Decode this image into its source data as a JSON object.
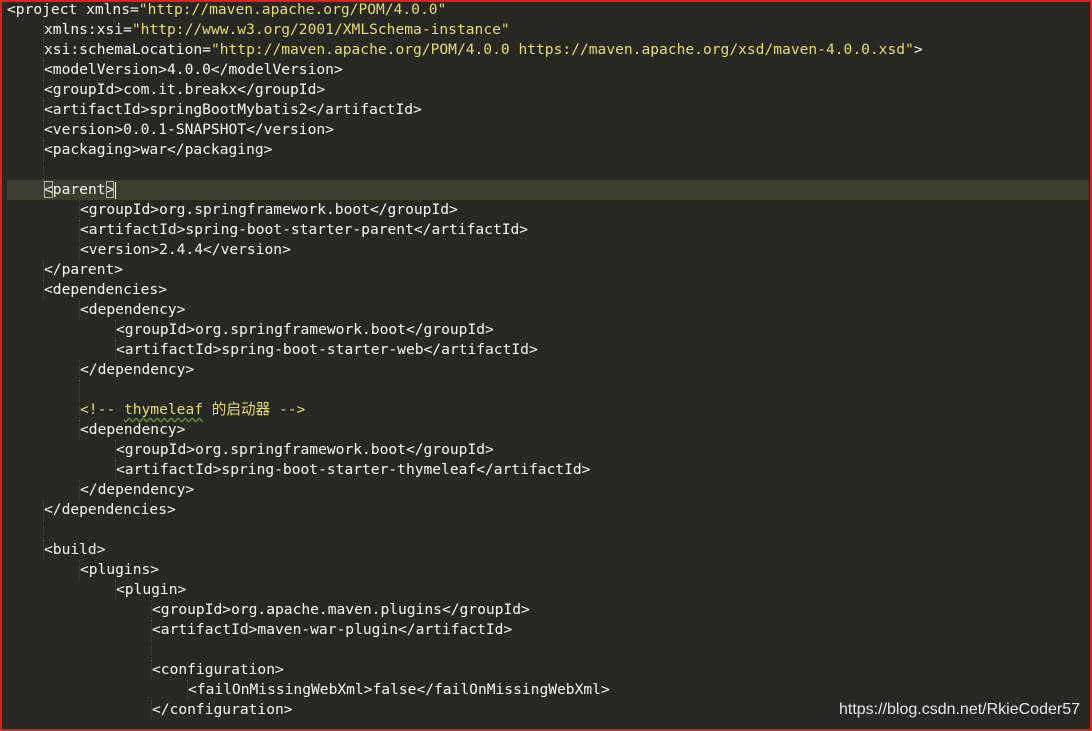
{
  "editor": {
    "lines": [
      [
        "<project xmlns=",
        "\"http://maven.apache.org/POM/4.0.0\""
      ],
      [
        "xmlns:xsi=",
        "\"http://www.w3.org/2001/XMLSchema-instance\""
      ],
      [
        "xsi:schemaLocation=",
        "\"http://maven.apache.org/POM/4.0.0 https://maven.apache.org/xsd/maven-4.0.0.xsd\"",
        ">"
      ],
      [
        "<modelVersion>4.0.0</modelVersion>"
      ],
      [
        "<groupId>com.it.breakx</groupId>"
      ],
      [
        "<artifactId>springBootMybatis2</artifactId>"
      ],
      [
        "<version>0.0.1-SNAPSHOT</version>"
      ],
      [
        "<packaging>war</packaging>"
      ],
      [
        ""
      ],
      [
        "<",
        "parent",
        ">"
      ],
      [
        "<groupId>org.springframework.boot</groupId>"
      ],
      [
        "<artifactId>spring-boot-starter-parent</artifactId>"
      ],
      [
        "<version>2.4.4</version>"
      ],
      [
        "</parent>"
      ],
      [
        "<dependencies>"
      ],
      [
        "<dependency>"
      ],
      [
        "<groupId>org.springframework.boot</groupId>"
      ],
      [
        "<artifactId>spring-boot-starter-web</artifactId>"
      ],
      [
        "</dependency>"
      ],
      [
        ""
      ],
      [
        "<!-- ",
        "thymeleaf",
        " 的启动器 -->"
      ],
      [
        "<dependency>"
      ],
      [
        "<groupId>org.springframework.boot</groupId>"
      ],
      [
        "<artifactId>spring-boot-starter-thymeleaf</artifactId>"
      ],
      [
        "</dependency>"
      ],
      [
        "</dependencies>"
      ],
      [
        ""
      ],
      [
        "<build>"
      ],
      [
        "<plugins>"
      ],
      [
        "<plugin>"
      ],
      [
        "<groupId>org.apache.maven.plugins</groupId>"
      ],
      [
        "<artifactId>maven-war-plugin</artifactId>"
      ],
      [
        ""
      ],
      [
        "<configuration>"
      ],
      [
        "<failOnMissingWebXml>false</failOnMissingWebXml>"
      ],
      [
        "</configuration>"
      ]
    ]
  },
  "watermark": "https://blog.csdn.net/RkieCoder57",
  "colors": {
    "background": "#272822",
    "text": "#f8f8f2",
    "string": "#e6db74",
    "comment": "#e6db74",
    "current_line": "#3e3d32",
    "frame_border": "#e0201b"
  }
}
